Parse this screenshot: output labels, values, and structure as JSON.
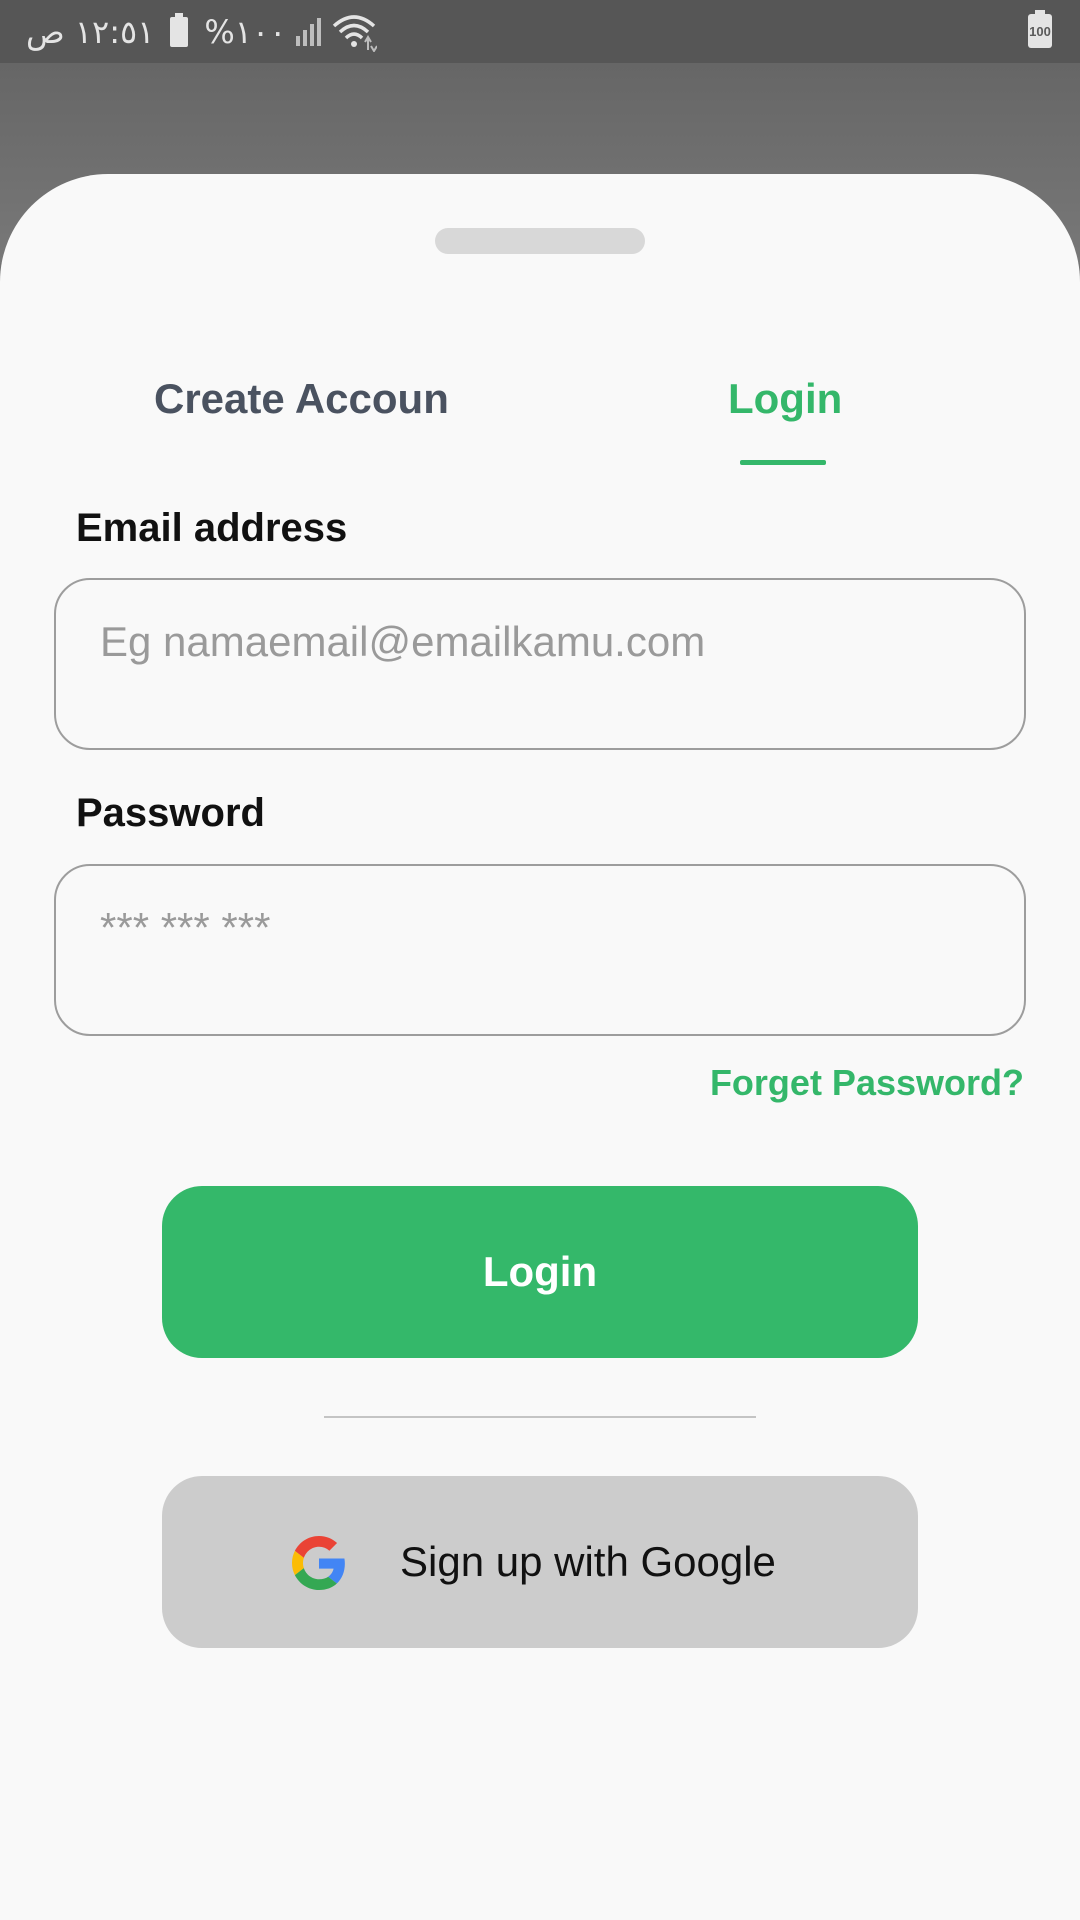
{
  "status_bar": {
    "time": "١٢:٥١ ص",
    "battery_percent": "%١٠٠",
    "battery_level_label": "100"
  },
  "tabs": {
    "create_account": "Create Accoun",
    "login": "Login",
    "active": "login"
  },
  "form": {
    "email_label": "Email address",
    "email_placeholder": "Eg namaemail@emailkamu.com",
    "email_value": "",
    "password_label": "Password",
    "password_placeholder": "*** *** ***",
    "password_value": "",
    "forget_password": "Forget Password?"
  },
  "actions": {
    "login_button": "Login",
    "google_button": "Sign up with Google"
  },
  "icons": {
    "google": "google-icon",
    "wifi": "wifi-icon",
    "signal": "signal-icon",
    "battery": "battery-icon"
  },
  "colors": {
    "accent": "#34b76a",
    "tab_inactive": "#4a5260",
    "google_button_bg": "#cccccc"
  }
}
